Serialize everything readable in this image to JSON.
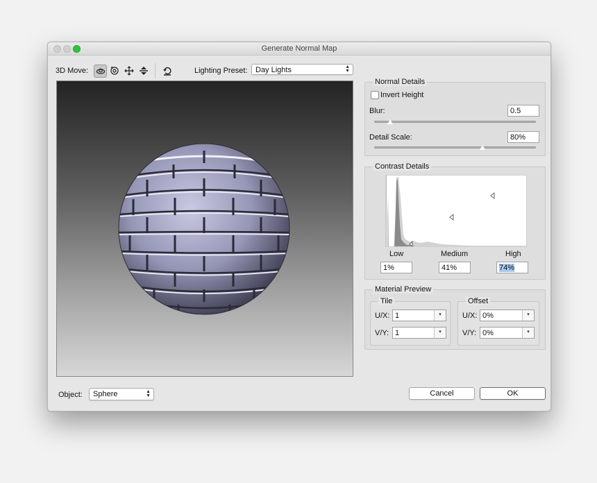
{
  "window": {
    "title": "Generate Normal Map",
    "controls": {
      "close_color": "#d0d0d0",
      "minimize_color": "#d0d0d0",
      "zoom_color": "#2fc53a"
    }
  },
  "toolbar": {
    "move_label": "3D Move:",
    "tools": [
      {
        "icon": "orbit-icon",
        "selected": true
      },
      {
        "icon": "roll-icon",
        "selected": false
      },
      {
        "icon": "pan-icon",
        "selected": false
      },
      {
        "icon": "slide-icon",
        "selected": false
      }
    ],
    "reset_icon": "reset-view-icon",
    "lighting_label": "Lighting Preset:",
    "lighting_value": "Day Lights"
  },
  "preview": {
    "object": "brick-sphere",
    "background": [
      "#232323",
      "#d7d7d7"
    ],
    "tint": "#9c9cbd"
  },
  "normal_details": {
    "title": "Normal Details",
    "invert_label": "Invert Height",
    "invert_checked": false,
    "blur_label": "Blur:",
    "blur_value": "0.5",
    "blur_slider": 0.1,
    "detail_label": "Detail Scale:",
    "detail_value": "80%",
    "detail_slider": 0.67
  },
  "contrast_details": {
    "title": "Contrast Details",
    "low_label": "Low",
    "medium_label": "Medium",
    "high_label": "High",
    "low_value": "1%",
    "medium_value": "41%",
    "high_value": "74%"
  },
  "material_preview": {
    "title": "Material Preview",
    "tile": {
      "title": "Tile",
      "ux_label": "U/X:",
      "ux_value": "1",
      "vy_label": "V/Y:",
      "vy_value": "1"
    },
    "offset": {
      "title": "Offset",
      "ux_label": "U/X:",
      "ux_value": "0%",
      "vy_label": "V/Y:",
      "vy_value": "0%"
    }
  },
  "footer": {
    "object_label": "Object:",
    "object_value": "Sphere",
    "cancel_label": "Cancel",
    "ok_label": "OK"
  }
}
